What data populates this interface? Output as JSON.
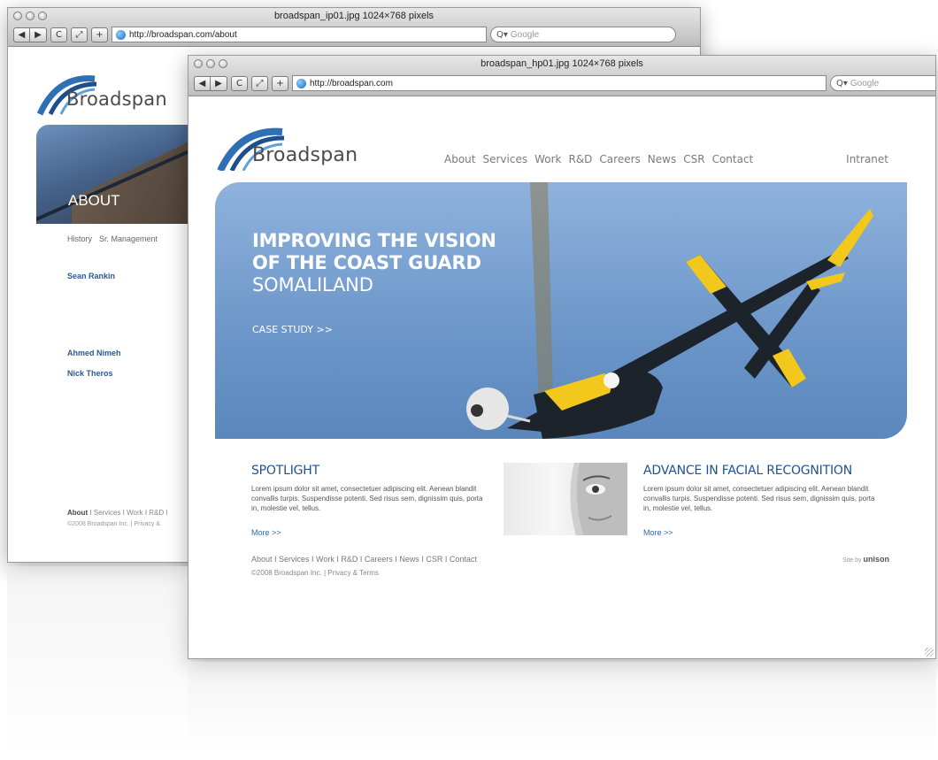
{
  "back_window": {
    "title": "broadspan_ip01.jpg 1024×768 pixels",
    "url": "http://broadspan.com/about",
    "search_placeholder": "Google",
    "logo_text": "Broadspan",
    "hero_title": "ABOUT",
    "subnav": [
      "History",
      "Sr. Management"
    ],
    "names": [
      "Sean Rankin",
      "Ahmed Nimeh",
      "Nick Theros"
    ],
    "footer_active": "About",
    "footer_rest": " I Services I Work I R&D I",
    "copyright": "©2008 Broadspan Inc. |  Privacy &"
  },
  "front_window": {
    "title": "broadspan_hp01.jpg 1024×768 pixels",
    "url": "http://broadspan.com",
    "search_placeholder": "Google",
    "logo_text": "Broadspan",
    "nav": [
      "About",
      "Services",
      "Work",
      "R&D",
      "Careers",
      "News",
      "CSR",
      "Contact"
    ],
    "intranet": "Intranet",
    "hero": {
      "line1": "IMPROVING THE VISION",
      "line2": "OF THE COAST GUARD",
      "line3": "SOMALILAND",
      "cta": "CASE STUDY >>"
    },
    "spotlight": {
      "title": "SPOTLIGHT",
      "body": "Lorem ipsum dolor sit amet, consectetuer adipiscing elit. Aenean blandit convallis turpis. Suspendisse potenti. Sed risus sem, dignissim quis, porta in, molestie vel, tellus.",
      "more": "More >>"
    },
    "feature": {
      "title": "ADVANCE IN FACIAL RECOGNITION",
      "body": "Lorem ipsum dolor sit amet, consectetuer adipiscing elit. Aenean blandit convallis turpis. Suspendisse potenti. Sed risus sem, dignissim quis, porta in, molestie vel, tellus.",
      "more": "More >>"
    },
    "footer_links": "About I Services I Work I R&D I Careers I News I CSR I Contact",
    "copyright": "©2008 Broadspan Inc.  |   Privacy & Terms",
    "site_by_label": "Site by",
    "site_by_name": "unison"
  },
  "toolbar": {
    "back_glyph": "◀",
    "forward_glyph": "▶",
    "reload_glyph": "C",
    "snapback_glyph": "⤢",
    "add_glyph": "+",
    "search_glyph": "Q▾"
  },
  "colors": {
    "brand_blue": "#1f5390",
    "link_blue": "#2e6aab",
    "hero_sky": "#6e98ca",
    "helicopter_yellow": "#f2c81c"
  }
}
